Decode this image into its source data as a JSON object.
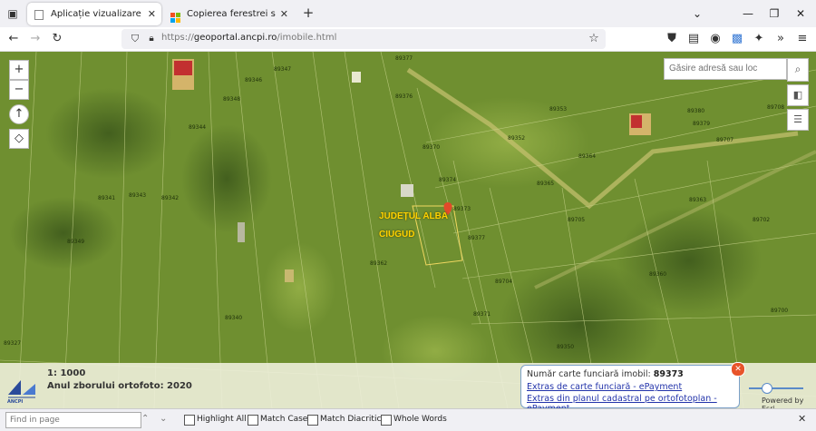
{
  "browser": {
    "tabs": [
      {
        "title": "Aplicație vizualizare imobile",
        "active": true
      },
      {
        "title": "Copierea ferestrei sau a conținu",
        "active": false
      }
    ],
    "url_prefix": "https://",
    "url_domain": "geoportal.ancpi.ro",
    "url_path": "/imobile.html"
  },
  "map": {
    "search_placeholder": "Găsire adresă sau loc",
    "pin_label_county": "JUDEȚUL ALBA",
    "pin_label_locality": "CIUGUD",
    "parcels": [
      "89347",
      "89346",
      "89348",
      "89344",
      "89343",
      "89341",
      "89342",
      "89349",
      "89340",
      "89327",
      "89377",
      "89376",
      "89370",
      "89374",
      "89373",
      "89377",
      "89362",
      "89371",
      "89353",
      "89352",
      "89364",
      "89365",
      "89379",
      "89380",
      "89707",
      "89704",
      "89705",
      "89702",
      "89700",
      "89360",
      "89350",
      "89708",
      "89363"
    ],
    "scale_text": "1: 1000",
    "year_text": "Anul zborului ortofoto: 2020",
    "popup": {
      "title_prefix": "Număr carte funciară imobil: ",
      "number": "89373",
      "link1": "Extras de carte funciară - ePayment",
      "link2": "Extras din planul cadastral pe ortofotoplan - ePayment"
    },
    "powered": "Powered by Esri",
    "logo_text": "ANCPI"
  },
  "findbar": {
    "placeholder": "Find in page",
    "options": [
      "Highlight All",
      "Match Case",
      "Match Diacritics",
      "Whole Words"
    ]
  }
}
